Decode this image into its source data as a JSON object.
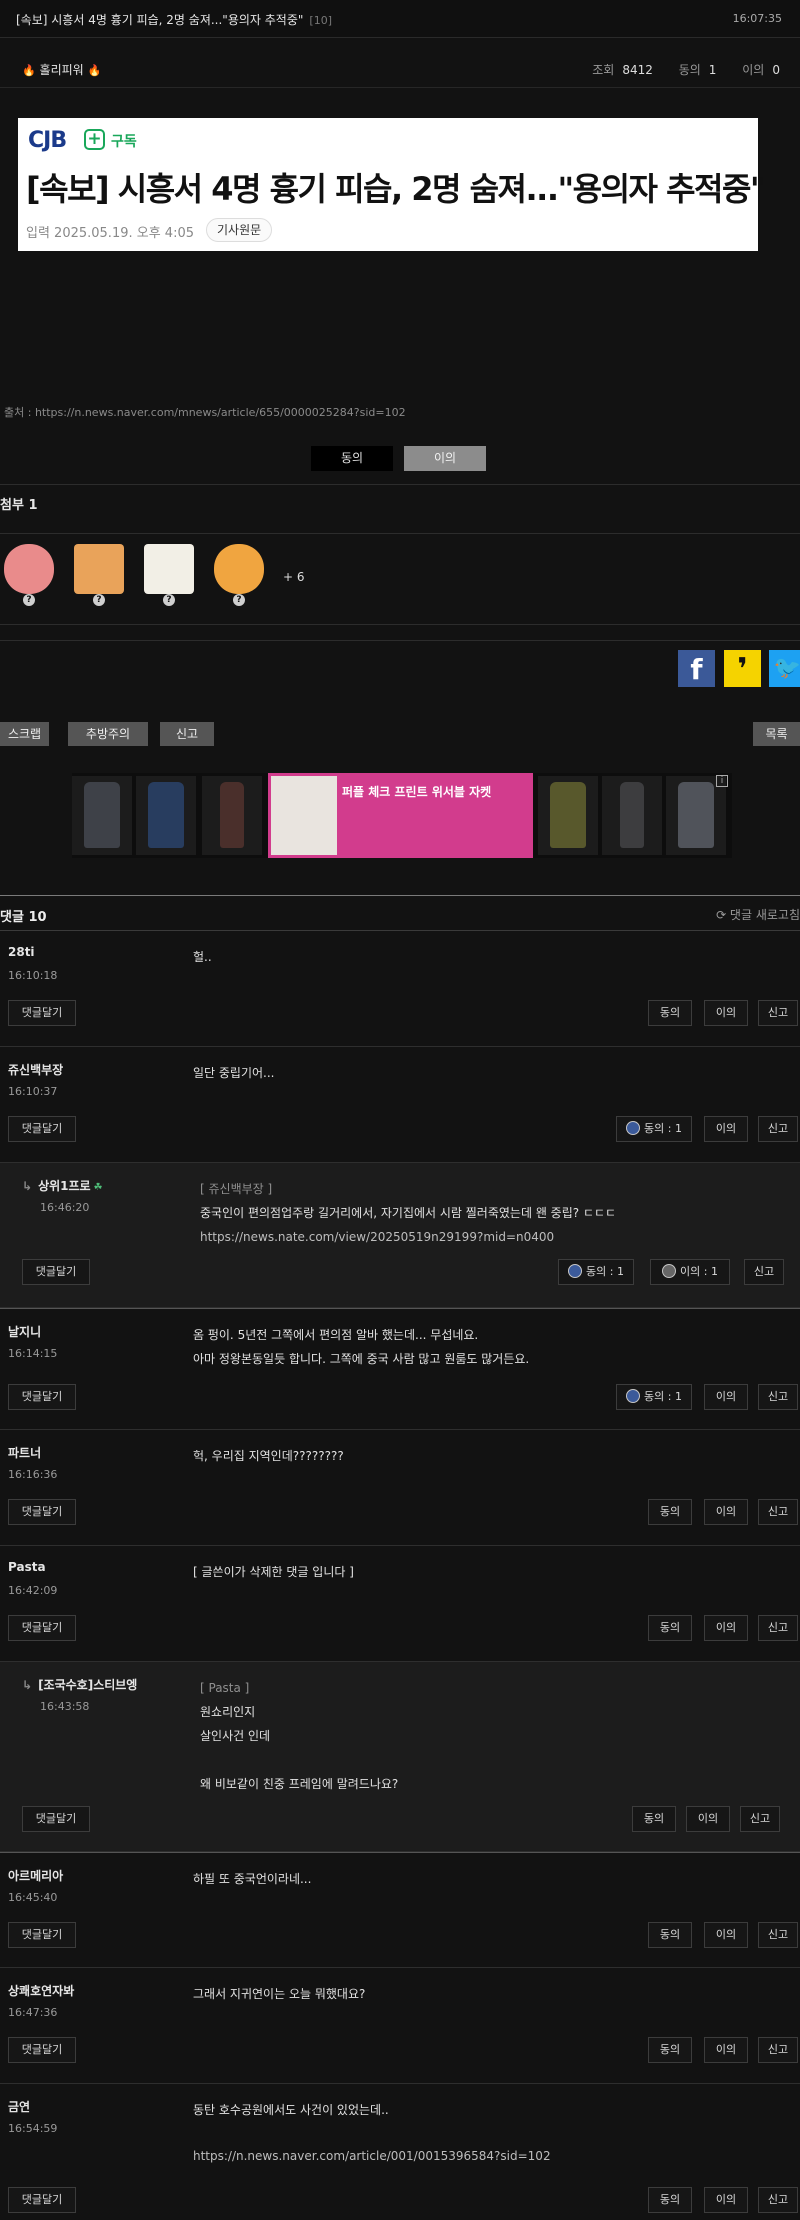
{
  "title_bar": {
    "title": "[속보] 시흥서 4명 흉기 피습, 2명 숨져...\"용의자 추적중\"",
    "comment_count": "[10]",
    "time": "16:07:35"
  },
  "meta": {
    "author": "홀리피워",
    "views_label": "조회",
    "views": "8412",
    "agree_label": "동의",
    "agree": "1",
    "disagree_label": "이의",
    "disagree": "0"
  },
  "news_card": {
    "logo": "CJB",
    "subscribe_icon": "+",
    "subscribe": "구독",
    "headline": "[속보] 시흥서 4명 흉기 피습, 2명 숨져...\"용의자 추적중\"",
    "date": "입력 2025.05.19. 오후 4:05",
    "original_button": "기사원문"
  },
  "source": "출처 : https://n.news.naver.com/mnews/article/655/0000025284?sid=102",
  "vote": {
    "agree": "동의",
    "disagree": "이의"
  },
  "attachments": {
    "title": "첨부 1",
    "emoticons": [
      {
        "q": "?",
        "color": "#e98b8b"
      },
      {
        "q": "?",
        "color": "#e9a35a"
      },
      {
        "q": "?",
        "color": "#f2efe6"
      },
      {
        "q": "?",
        "color": "#f0a540"
      }
    ],
    "more": "+ 6"
  },
  "share": {
    "facebook": "f",
    "kakaostory": "❜",
    "twitter": "🐦"
  },
  "actions": {
    "scrap": "스크랩",
    "warning": "추방주의",
    "report": "신고",
    "list": "목록"
  },
  "ad": {
    "featured_text": "퍼플 체크 프린트 위서블 자켓",
    "info": "i",
    "items": [
      {
        "color": "#3e4148"
      },
      {
        "color": "#283d5f"
      },
      {
        "color": "#4a2f2b"
      },
      {
        "color": "#58582c"
      },
      {
        "color": "#3d3d3f"
      },
      {
        "color": "#50535a"
      }
    ]
  },
  "comments_section": {
    "title": "댓글 10",
    "refresh": "⟳ 댓글 새로고침"
  },
  "buttons": {
    "reply": "댓글달기",
    "agree": "동의",
    "disagree": "이의",
    "report": "신고",
    "arrow": "↳"
  },
  "comments": [
    {
      "name": "28ti",
      "time": "16:10:18",
      "line1": "헐.."
    },
    {
      "name": "쥬신백부장",
      "time": "16:10:37",
      "line1": "일단 중립기어...",
      "agree": "동의 : 1"
    },
    {
      "name": "상위1프로",
      "badge": "☘",
      "time": "16:46:20",
      "quote": "[ 쥬신백부장 ]",
      "line1": "중국인이 편의점업주랑 길거리에서, 자기집에서 시람 찔러죽였는데 왠 중립? ㄷㄷㄷ",
      "link": "https://news.nate.com/view/20250519n29199?mid=n0400",
      "agree": "동의 : 1",
      "disagree": "이의 : 1"
    },
    {
      "name": "날지니",
      "time": "16:14:15",
      "line1": "옴 펑이. 5년전 그쪽에서 편의점 알바 했는데... 무섭네요.",
      "line2": "아마 정왕본동일듯 합니다. 그쪽에 중국 사람 많고 원룸도 많거든요.",
      "agree": "동의 : 1"
    },
    {
      "name": "파트너",
      "time": "16:16:36",
      "line1": "헉, 우리집 지역인데????????"
    },
    {
      "name": "Pasta",
      "time": "16:42:09",
      "line1": "[ 글쓴이가 삭제한 댓글 입니다 ]"
    },
    {
      "name": "[조국수호]스티브엥",
      "time": "16:43:58",
      "quote": "[ Pasta ]",
      "line1": "원쇼리인지",
      "line2": "살인사건 인데",
      "line4": "왜 비보같이 친중 프레임에 말려드나요?"
    },
    {
      "name": "아르메리아",
      "time": "16:45:40",
      "line1": "하필 또 중국언이라네..."
    },
    {
      "name": "상쾌호연자봐",
      "time": "16:47:36",
      "line1": "그래서 지귀연이는 오늘 뭐했대요?"
    },
    {
      "name": "금연",
      "time": "16:54:59",
      "line1": "동탄 호수공원에서도 사건이 있었는데..",
      "link": "https://n.news.naver.com/article/001/0015396584?sid=102"
    }
  ]
}
